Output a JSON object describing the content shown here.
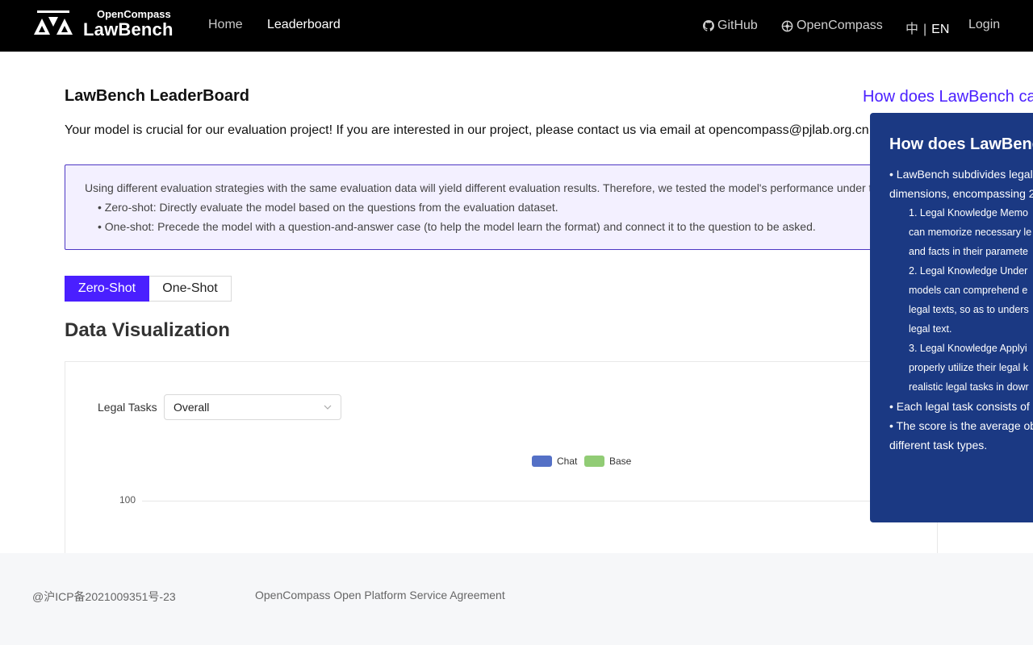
{
  "nav": {
    "logo_small": "OpenCompass",
    "logo_big": "LawBench",
    "links": [
      "Home",
      "Leaderboard"
    ],
    "github": "GitHub",
    "opencompass": "OpenCompass",
    "lang_zh": "中",
    "lang_sep": "|",
    "lang_en": "EN",
    "login": "Login"
  },
  "main": {
    "title": "LawBench LeaderBoard",
    "contact": "Your model is crucial for our evaluation project! If you are interested in our project, please contact us via email at opencompass@pjlab.org.cn",
    "how_link": "How does LawBench ca",
    "notice": {
      "line1": "Using different evaluation strategies with the same evaluation data will yield different evaluation results. Therefore, we tested the model's performance under t",
      "line2": "• Zero-shot: Directly evaluate the model based on the questions from the evaluation dataset.",
      "line3": "• One-shot: Precede the model with a question-and-answer case (to help the model learn the format) and connect it to the question to be asked."
    },
    "tabs": [
      "Zero-Shot",
      "One-Shot"
    ],
    "active_tab": "Zero-Shot",
    "dv_title": "Data Visualization",
    "legal_tasks_label": "Legal Tasks",
    "legal_tasks_value": "Overall"
  },
  "chart_data": {
    "type": "bar",
    "series": [
      {
        "name": "Chat",
        "color": "#5470c6",
        "values": []
      },
      {
        "name": "Base",
        "color": "#91cc75",
        "values": []
      }
    ],
    "y_ticks_visible": [
      "100"
    ],
    "legend": "top-center"
  },
  "panel": {
    "title": "How does LawBenc",
    "lines": [
      "• LawBench subdivides legal",
      "dimensions, encompassing 2",
      "1. Legal Knowledge Memo",
      "can memorize necessary le",
      "and facts in their paramete",
      "2. Legal Knowledge Under",
      "models can comprehend e",
      "legal texts, so as to unders",
      "legal text.",
      "3. Legal Knowledge Applyi",
      "properly utilize their legal k",
      "realistic legal tasks in dowr",
      "• Each legal task consists of",
      "• The score is the average ob",
      "different task types."
    ]
  },
  "footer": {
    "icp": "@沪ICP备2021009351号-23",
    "agreement": "OpenCompass Open Platform Service Agreement"
  },
  "colors": {
    "accent": "#4a1fff",
    "panel_bg": "#1b3983",
    "notice_bg": "#f3f0ff",
    "topbar": "#000000"
  }
}
